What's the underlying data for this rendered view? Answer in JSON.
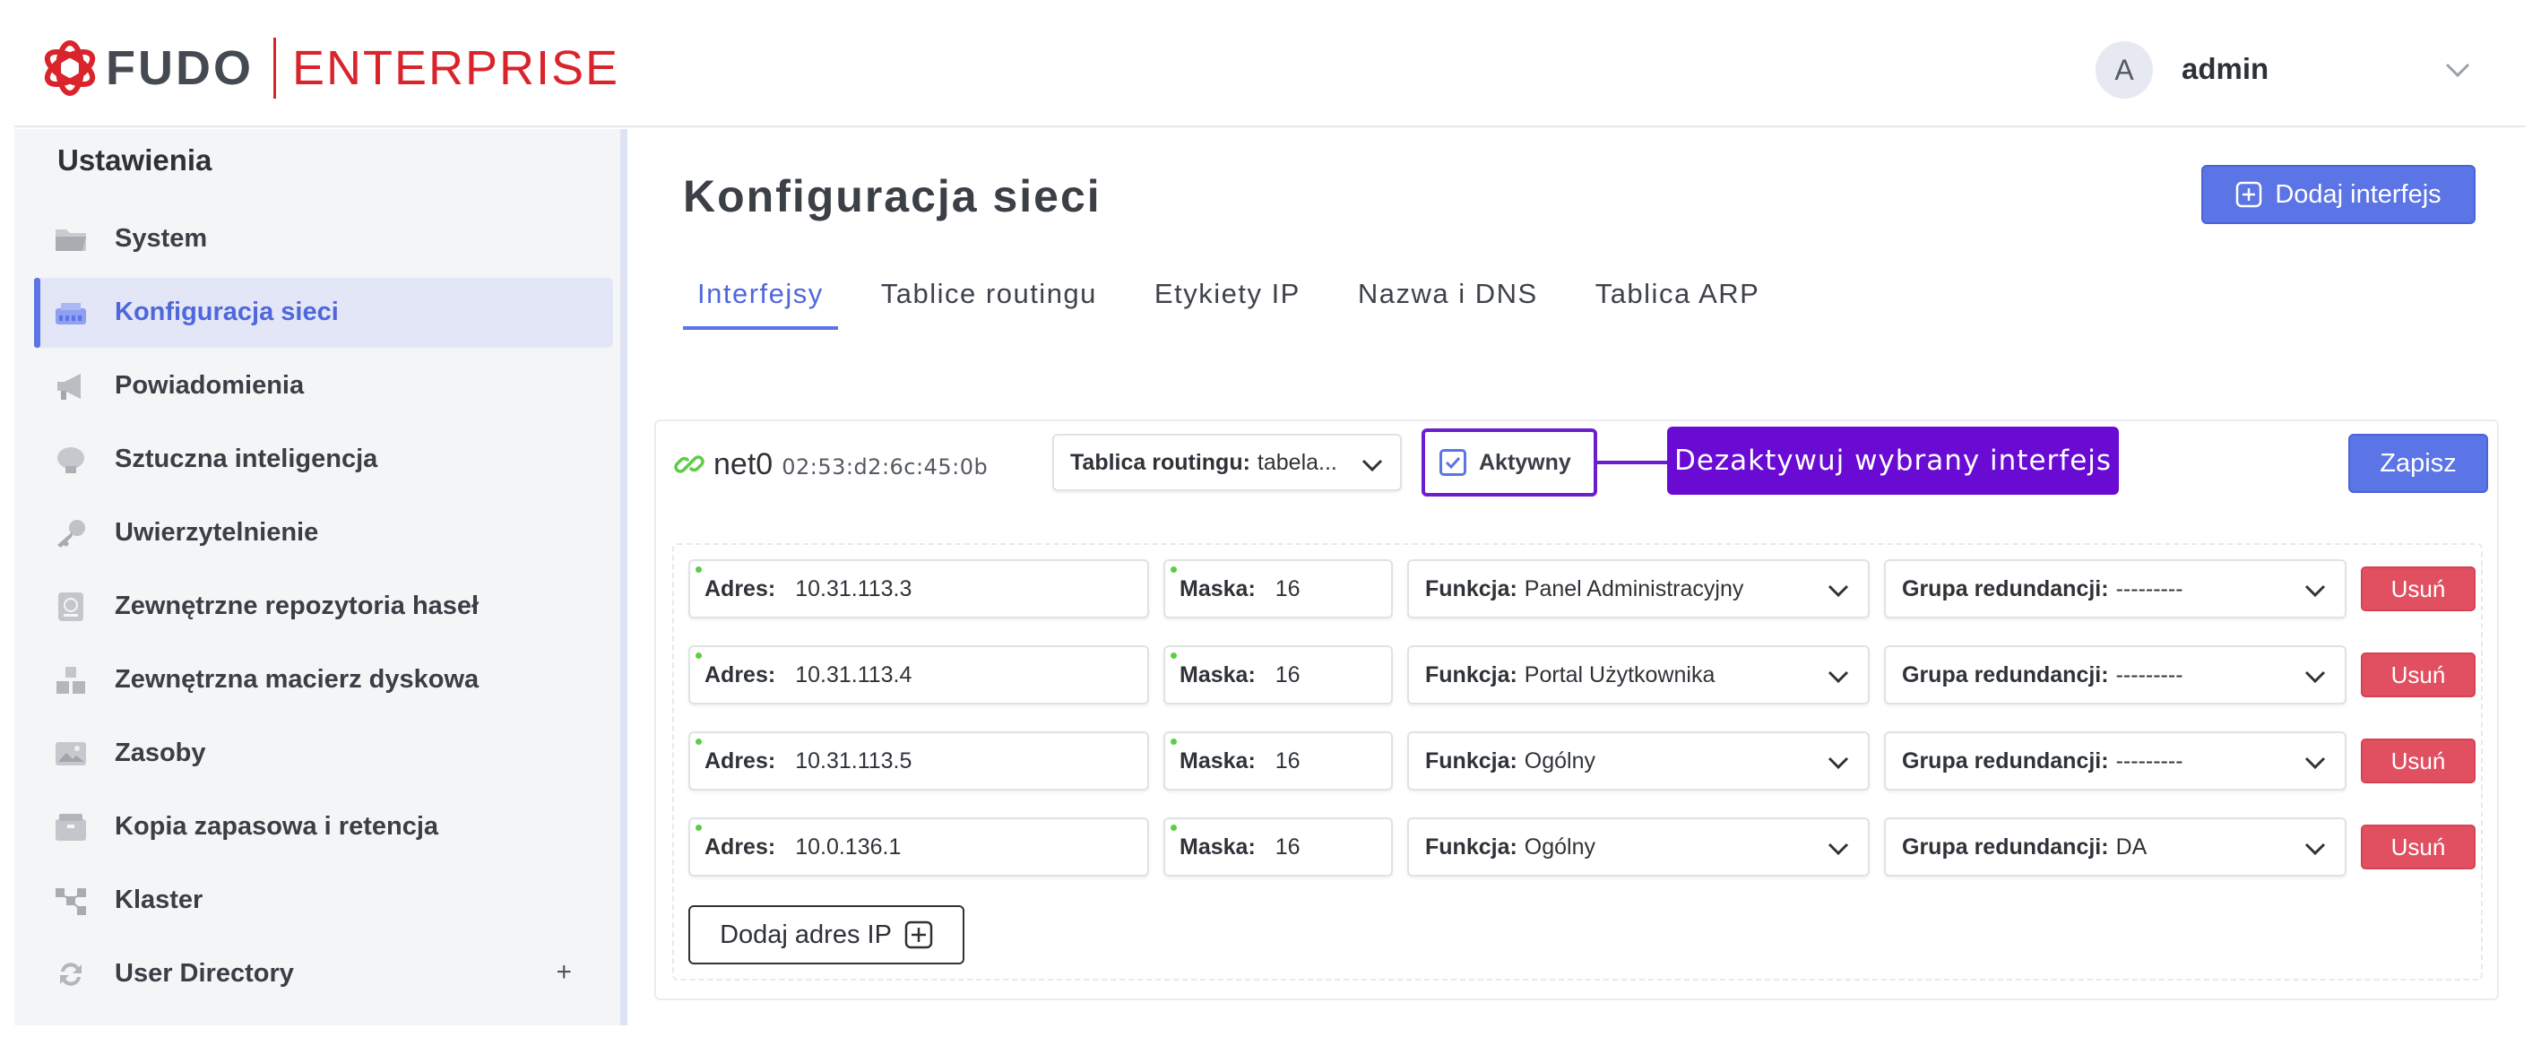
{
  "header": {
    "logo_fudo": "FUDO",
    "logo_enterprise": "ENTERPRISE",
    "avatar_letter": "A",
    "user_name": "admin"
  },
  "sidebar": {
    "title": "Ustawienia",
    "items": [
      {
        "label": "System",
        "icon": "folder-icon",
        "active": false
      },
      {
        "label": "Konfiguracja sieci",
        "icon": "network-icon",
        "active": true
      },
      {
        "label": "Powiadomienia",
        "icon": "megaphone-icon",
        "active": false
      },
      {
        "label": "Sztuczna inteligencja",
        "icon": "brain-icon",
        "active": false
      },
      {
        "label": "Uwierzytelnienie",
        "icon": "key-icon",
        "active": false
      },
      {
        "label": "Zewnętrzne repozytoria haseł",
        "icon": "vault-icon",
        "active": false
      },
      {
        "label": "Zewnętrzna macierz dyskowa",
        "icon": "storage-icon",
        "active": false
      },
      {
        "label": "Zasoby",
        "icon": "image-icon",
        "active": false
      },
      {
        "label": "Kopia zapasowa i retencja",
        "icon": "archive-icon",
        "active": false
      },
      {
        "label": "Klaster",
        "icon": "cluster-icon",
        "active": false
      },
      {
        "label": "User Directory",
        "icon": "sync-icon",
        "active": false,
        "expand": "+"
      }
    ]
  },
  "main": {
    "title": "Konfiguracja sieci",
    "add_interface_label": "Dodaj interfejs",
    "tabs": [
      {
        "label": "Interfejsy",
        "active": true
      },
      {
        "label": "Tablice routingu",
        "active": false
      },
      {
        "label": "Etykiety IP",
        "active": false
      },
      {
        "label": "Nazwa i DNS",
        "active": false
      },
      {
        "label": "Tablica ARP",
        "active": false
      }
    ],
    "interface": {
      "name": "net0",
      "mac": "02:53:d2:6c:45:0b",
      "routing_label": "Tablica routingu:",
      "routing_value": "tabela...",
      "active_label": "Aktywny",
      "active_checked": true,
      "callout": "Dezaktywuj wybrany interfejs",
      "save_label": "Zapisz",
      "addresses": [
        {
          "addr_label": "Adres:",
          "addr": "10.31.113.3",
          "mask_label": "Maska:",
          "mask": "16",
          "func_label": "Funkcja:",
          "func": "Panel Administracyjny",
          "group_label": "Grupa redundancji:",
          "group": "---------",
          "delete_label": "Usuń"
        },
        {
          "addr_label": "Adres:",
          "addr": "10.31.113.4",
          "mask_label": "Maska:",
          "mask": "16",
          "func_label": "Funkcja:",
          "func": "Portal Użytkownika",
          "group_label": "Grupa redundancji:",
          "group": "---------",
          "delete_label": "Usuń"
        },
        {
          "addr_label": "Adres:",
          "addr": "10.31.113.5",
          "mask_label": "Maska:",
          "mask": "16",
          "func_label": "Funkcja:",
          "func": "Ogólny",
          "group_label": "Grupa redundancji:",
          "group": "---------",
          "delete_label": "Usuń"
        },
        {
          "addr_label": "Adres:",
          "addr": "10.0.136.1",
          "mask_label": "Maska:",
          "mask": "16",
          "func_label": "Funkcja:",
          "func": "Ogólny",
          "group_label": "Grupa redundancji:",
          "group": "DA",
          "delete_label": "Usuń"
        }
      ],
      "add_ip_label": "Dodaj adres IP"
    }
  },
  "colors": {
    "accent": "#5b74e6",
    "brand_red": "#d9242c",
    "callout_purple": "#6a0bd4",
    "danger": "#e05061",
    "status_green": "#5ccd46"
  }
}
